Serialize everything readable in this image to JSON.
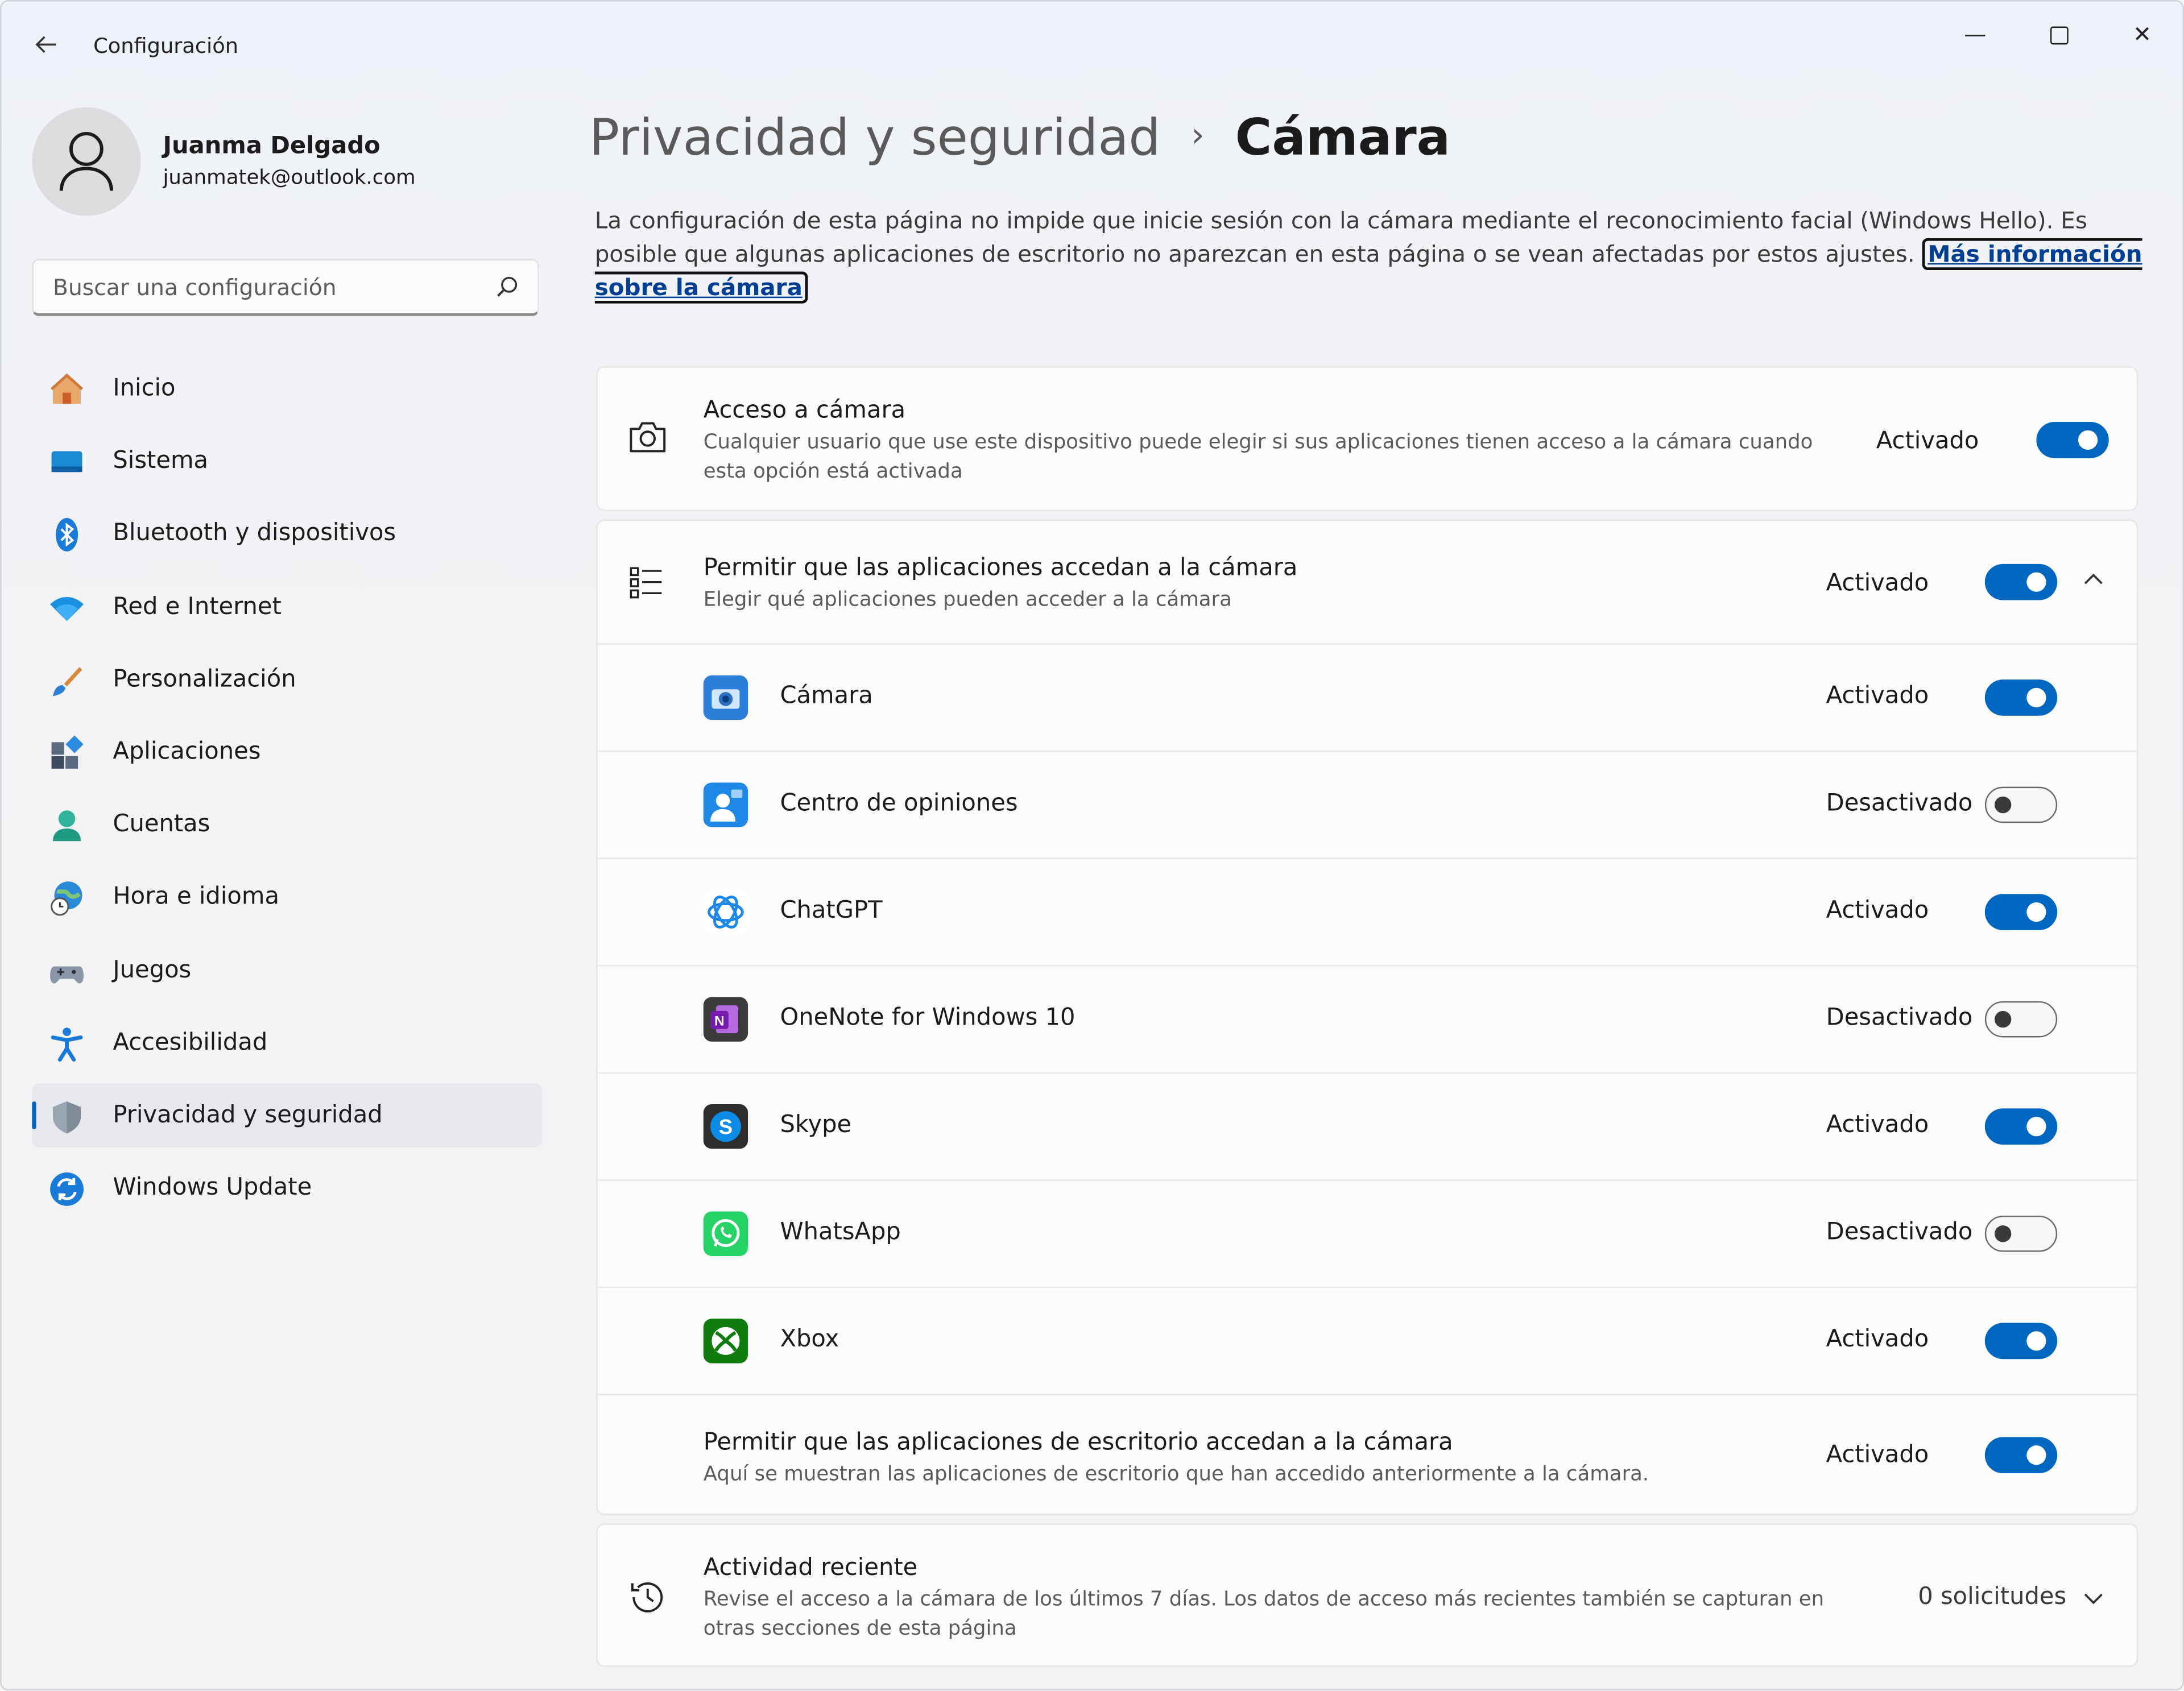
{
  "window": {
    "title": "Configuración",
    "controls": [
      "—",
      "✕"
    ]
  },
  "user": {
    "name": "Juanma Delgado",
    "email": "juanmatek@outlook.com"
  },
  "search": {
    "placeholder": "Buscar una configuración"
  },
  "sidebar": {
    "items": [
      {
        "label": "Inicio",
        "icon": "home-icon",
        "active": false
      },
      {
        "label": "Sistema",
        "icon": "monitor-icon",
        "active": false
      },
      {
        "label": "Bluetooth y dispositivos",
        "icon": "bluetooth-icon",
        "active": false
      },
      {
        "label": "Red e Internet",
        "icon": "wifi-icon",
        "active": false
      },
      {
        "label": "Personalización",
        "icon": "brush-icon",
        "active": false
      },
      {
        "label": "Aplicaciones",
        "icon": "apps-icon",
        "active": false
      },
      {
        "label": "Cuentas",
        "icon": "person-icon",
        "active": false
      },
      {
        "label": "Hora e idioma",
        "icon": "globe-clock-icon",
        "active": false
      },
      {
        "label": "Juegos",
        "icon": "gamepad-icon",
        "active": false
      },
      {
        "label": "Accesibilidad",
        "icon": "accessibility-icon",
        "active": false
      },
      {
        "label": "Privacidad y seguridad",
        "icon": "shield-icon",
        "active": true
      },
      {
        "label": "Windows Update",
        "icon": "update-icon",
        "active": false
      }
    ]
  },
  "breadcrumb": {
    "parent": "Privacidad y seguridad",
    "separator": "›",
    "current": "Cámara"
  },
  "intro": {
    "text": "La configuración de esta página no impide que inicie sesión con la cámara mediante el reconocimiento facial (Windows Hello). Es posible que algunas aplicaciones de escritorio no aparezcan en esta página o se vean afectadas por estos ajustes. ",
    "link": "Más información sobre la cámara"
  },
  "camera_access": {
    "title": "Acceso a cámara",
    "subtitle": "Cualquier usuario que use este dispositivo puede elegir si sus aplicaciones tienen acceso a la cámara cuando esta opción está activada",
    "state": "Activado",
    "on": true
  },
  "apps_access": {
    "title": "Permitir que las aplicaciones accedan a la cámara",
    "subtitle": "Elegir qué aplicaciones pueden acceder a la cámara",
    "state": "Activado",
    "on": true,
    "apps": [
      {
        "name": "Cámara",
        "state": "Activado",
        "on": true,
        "icon": "camera-app-icon",
        "color": "#2b7fd8"
      },
      {
        "name": "Centro de opiniones",
        "state": "Desactivado",
        "on": false,
        "icon": "feedback-hub-icon",
        "color": "#1f87e5"
      },
      {
        "name": "ChatGPT",
        "state": "Activado",
        "on": true,
        "icon": "chatgpt-icon",
        "color": "#1f87e5"
      },
      {
        "name": "OneNote for Windows 10",
        "state": "Desactivado",
        "on": false,
        "icon": "onenote-icon",
        "color": "#7719aa"
      },
      {
        "name": "Skype",
        "state": "Activado",
        "on": true,
        "icon": "skype-icon",
        "color": "#0c8ce6"
      },
      {
        "name": "WhatsApp",
        "state": "Desactivado",
        "on": false,
        "icon": "whatsapp-icon",
        "color": "#25d366"
      },
      {
        "name": "Xbox",
        "state": "Activado",
        "on": true,
        "icon": "xbox-icon",
        "color": "#107c10"
      }
    ],
    "desktop": {
      "title": "Permitir que las aplicaciones de escritorio accedan a la cámara",
      "subtitle": "Aquí se muestran las aplicaciones de escritorio que han accedido anteriormente a la cámara.",
      "state": "Activado",
      "on": true
    }
  },
  "recent": {
    "title": "Actividad reciente",
    "subtitle": "Revise el acceso a la cámara de los últimos 7 días. Los datos de acceso más recientes también se capturan en otras secciones de esta página",
    "count": "0 solicitudes"
  },
  "colors": {
    "accent": "#0067c0",
    "link": "#003e92"
  }
}
